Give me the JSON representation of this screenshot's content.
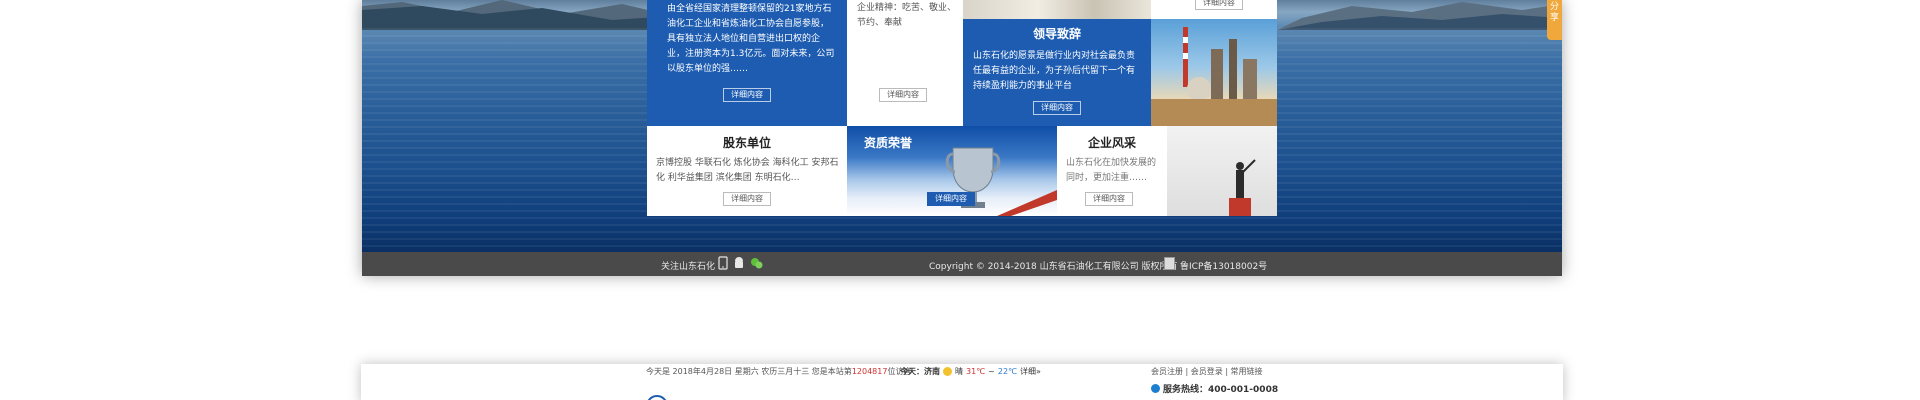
{
  "intro": {
    "text": "由全省经国家清理整顿保留的21家地方石油化工企业和省炼油化工协会自愿参股，具有独立法人地位和自营进出口权的企业，注册资本为1.3亿元。面对未来，公司以股东单位的强……",
    "more": "详细内容"
  },
  "culture": {
    "text": "企业精神：吃苦、敬业、节约、奉献",
    "more": "详细内容",
    "top_more": "详细内容"
  },
  "leader": {
    "title": "领导致辞",
    "text": "山东石化的愿景是做行业内对社会最负责任最有益的企业，为子孙后代留下一个有持续盈利能力的事业平台",
    "more": "详细内容"
  },
  "shareholder": {
    "title": "股东单位",
    "text": "京博控股  华联石化  炼化协会  海科化工  安邦石化  利华益集团  滨化集团  东明石化…",
    "more": "详细内容"
  },
  "honor": {
    "title": "资质荣誉",
    "more": "详细内容"
  },
  "style": {
    "title": "企业风采",
    "text": "山东石化在加快发展的同时，更加注重……",
    "more": "详细内容"
  },
  "footer": {
    "follow": "关注山东石化",
    "copyright": "Copyright © 2014-2018  山东省石油化工有限公司 版权所有",
    "icp": "鲁ICP备13018002号"
  },
  "share": {
    "label": "分享"
  },
  "header": {
    "date_prefix": "今天是 2018年4月28日 星期六 农历三月十三   您是本站第",
    "visit_count": "1204817",
    "date_suffix": "位访客",
    "weather_city": "今天：济南",
    "weather_desc": "晴",
    "temp_high": "31℃",
    "temp_sep": "~",
    "temp_low": "22℃",
    "weather_more": "详细»",
    "links": "会员注册  |  会员登录   |   常用链接",
    "hotline": "服务热线：400-001-0008"
  },
  "colors": {
    "brand_blue": "#1d5cb1",
    "share_orange": "#f0a83c",
    "footer_gray": "#4a4a4a"
  }
}
